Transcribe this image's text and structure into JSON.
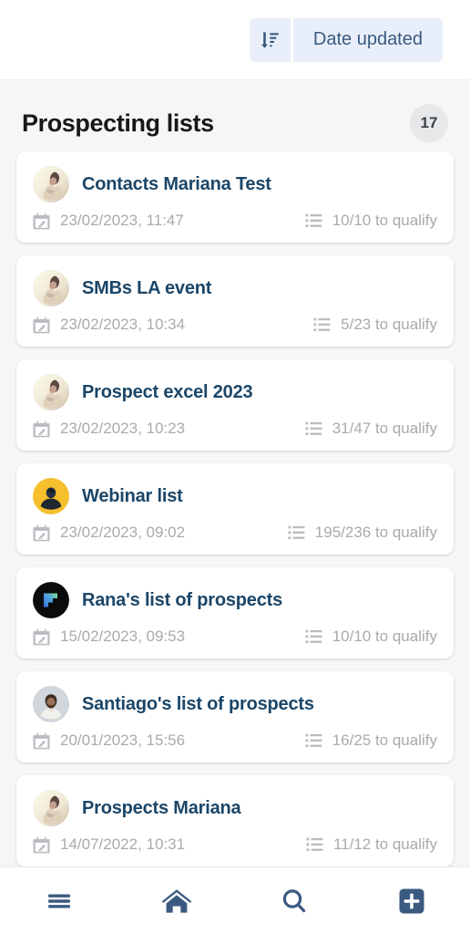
{
  "topbar": {
    "sort_icon": "sort-amount-down-icon",
    "sort_label": "Date updated"
  },
  "header": {
    "title": "Prospecting lists",
    "count": "17"
  },
  "lists": [
    {
      "title": "Contacts Mariana Test",
      "date": "23/02/2023, 11:47",
      "qualify": "10/10 to qualify",
      "avatar": "photo-cream",
      "date_icon": "calendar-edit-icon",
      "qualify_icon": "list-ul-icon"
    },
    {
      "title": "SMBs LA event",
      "date": "23/02/2023, 10:34",
      "qualify": "5/23 to qualify",
      "avatar": "photo-cream",
      "date_icon": "calendar-edit-icon",
      "qualify_icon": "list-ul-icon"
    },
    {
      "title": "Prospect excel 2023",
      "date": "23/02/2023, 10:23",
      "qualify": "31/47 to qualify",
      "avatar": "photo-cream",
      "date_icon": "calendar-edit-icon",
      "qualify_icon": "list-ul-icon"
    },
    {
      "title": "Webinar list",
      "date": "23/02/2023, 09:02",
      "qualify": "195/236 to qualify",
      "avatar": "photo-yellow",
      "date_icon": "calendar-edit-icon",
      "qualify_icon": "list-ul-icon"
    },
    {
      "title": "Rana's list of prospects",
      "date": "15/02/2023, 09:53",
      "qualify": "10/10 to qualify",
      "avatar": "logo-black-gradient",
      "date_icon": "calendar-edit-icon",
      "qualify_icon": "list-ul-icon"
    },
    {
      "title": "Santiago's list of prospects",
      "date": "20/01/2023, 15:56",
      "qualify": "16/25 to qualify",
      "avatar": "photo-gray",
      "date_icon": "calendar-edit-icon",
      "qualify_icon": "list-ul-icon"
    },
    {
      "title": "Prospects Mariana",
      "date": "14/07/2022, 10:31",
      "qualify": "11/12 to qualify",
      "avatar": "photo-cream",
      "date_icon": "calendar-edit-icon",
      "qualify_icon": "list-ul-icon"
    }
  ],
  "bottom_nav": [
    {
      "icon": "hamburger-menu-icon"
    },
    {
      "icon": "home-icon"
    },
    {
      "icon": "search-icon"
    },
    {
      "icon": "add-square-icon"
    }
  ],
  "colors": {
    "accent": "#3b5a80",
    "title_blue": "#1b4668",
    "sort_bg": "#e8effa",
    "page_bg": "#f5f6f7",
    "muted_text": "#a7abaf"
  }
}
